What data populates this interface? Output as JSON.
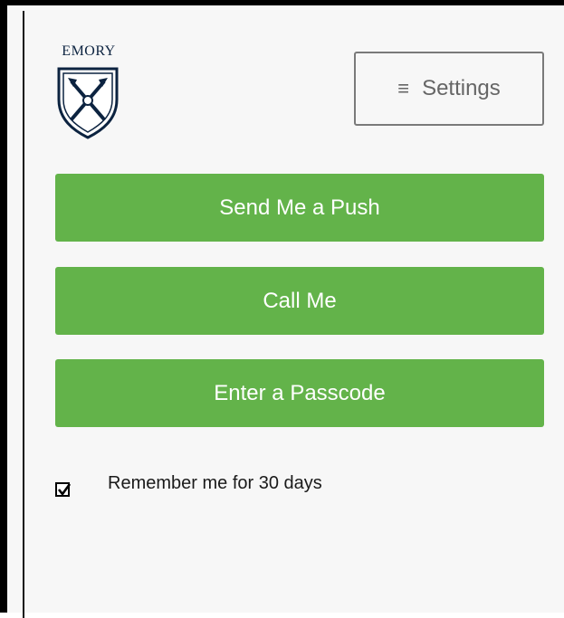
{
  "brand": {
    "logo_text": "EMORY",
    "navy": "#0c2340"
  },
  "settings": {
    "icon": "hamburger-menu-icon",
    "label": "Settings"
  },
  "actions": [
    {
      "label": "Send Me a Push"
    },
    {
      "label": "Call Me"
    },
    {
      "label": "Enter a Passcode"
    }
  ],
  "remember": {
    "label": "Remember me for 30 days",
    "checked": true
  },
  "colors": {
    "button_green": "#63b34a",
    "button_text": "#ffffff",
    "settings_border": "#7a7a7a",
    "background": "#f7f7f7"
  }
}
